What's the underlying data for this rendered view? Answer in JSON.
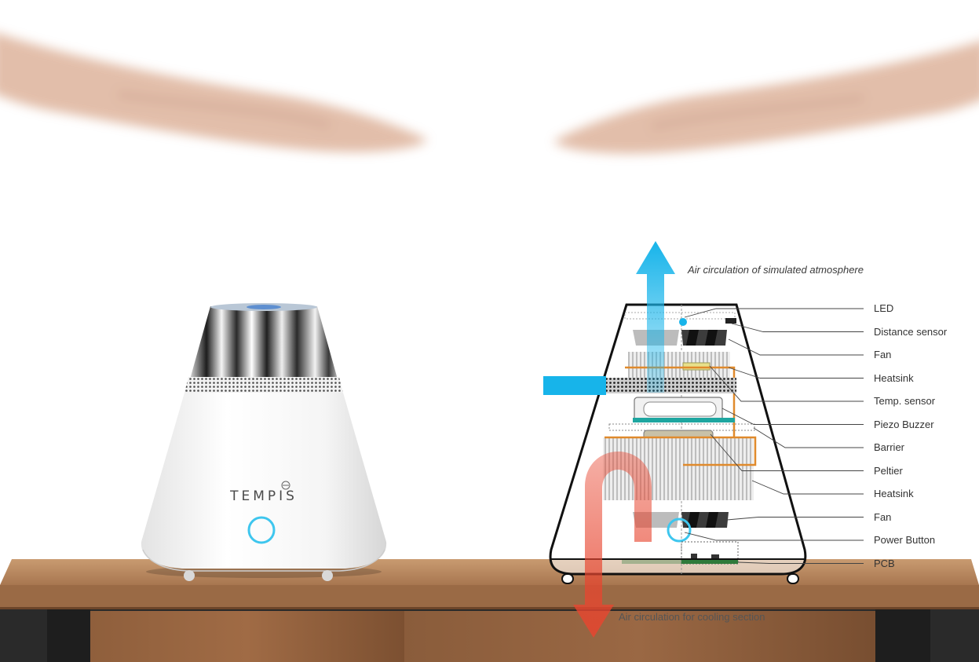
{
  "product": {
    "brand_name": "TEMPIS"
  },
  "captions": {
    "air_top": "Air circulation of simulated atmosphere",
    "air_bottom": "Air circulation for cooling section"
  },
  "callouts": [
    {
      "id": "led",
      "label": "LED"
    },
    {
      "id": "distance-sensor",
      "label": "Distance sensor"
    },
    {
      "id": "fan-top",
      "label": "Fan"
    },
    {
      "id": "heatsink-top",
      "label": "Heatsink"
    },
    {
      "id": "temp-sensor",
      "label": "Temp. sensor"
    },
    {
      "id": "piezo-buzzer",
      "label": "Piezo Buzzer"
    },
    {
      "id": "barrier",
      "label": "Barrier"
    },
    {
      "id": "peltier",
      "label": "Peltier"
    },
    {
      "id": "heatsink-bottom",
      "label": "Heatsink"
    },
    {
      "id": "fan-bottom",
      "label": "Fan"
    },
    {
      "id": "power-button",
      "label": "Power Button"
    },
    {
      "id": "pcb",
      "label": "PCB"
    }
  ],
  "colors": {
    "cool_air": "#17b4ea",
    "hot_air": "#e8452f",
    "wood": "#b6865a",
    "ring": "#3ec6ee",
    "heater_wire": "#e08a2c"
  }
}
